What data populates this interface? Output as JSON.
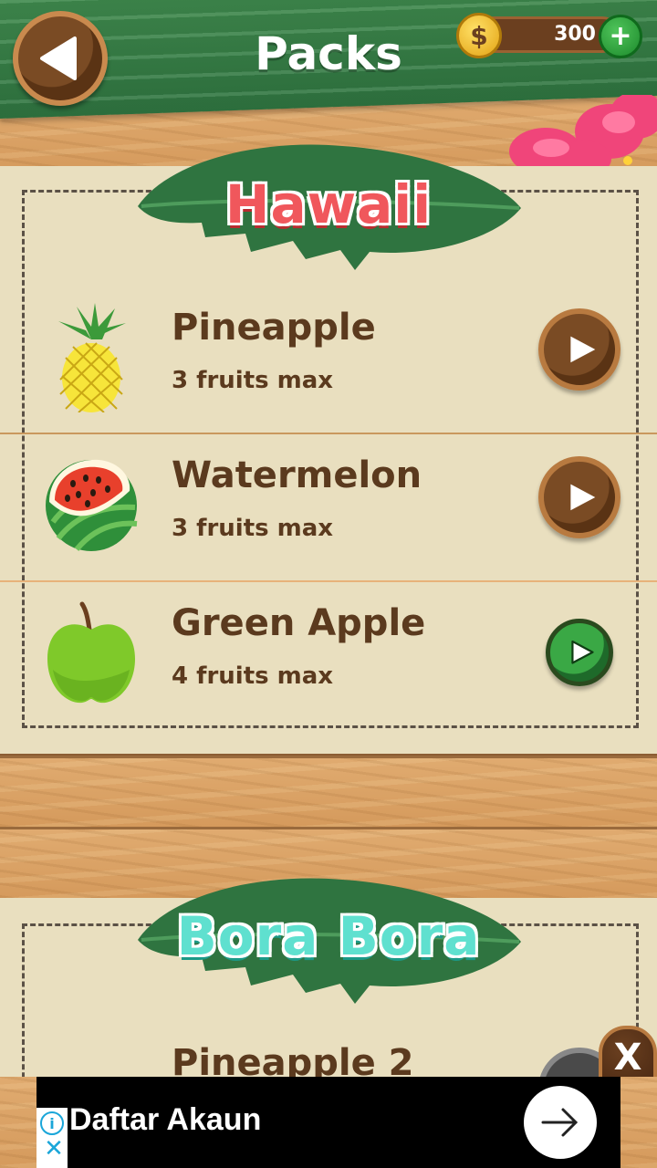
{
  "header": {
    "title": "Packs",
    "coins": "300",
    "coin_symbol": "$",
    "plus_symbol": "+"
  },
  "packs": [
    {
      "name": "Hawaii",
      "color": "#f0575c",
      "items": [
        {
          "name": "Pineapple",
          "max": "3 fruits max",
          "icon": "pineapple-icon",
          "button": "brown"
        },
        {
          "name": "Watermelon",
          "max": "3 fruits max",
          "icon": "watermelon-icon",
          "button": "brown"
        },
        {
          "name": "Green Apple",
          "max": "4 fruits max",
          "icon": "green-apple-icon",
          "button": "green"
        }
      ]
    },
    {
      "name": "Bora Bora",
      "color": "#5fe0cf",
      "items": [
        {
          "name": "Pineapple 2"
        }
      ]
    }
  ],
  "ad": {
    "text": "Daftar Akaun",
    "info_symbol": "i",
    "close_symbol": "✕",
    "dismiss_symbol": "X"
  }
}
